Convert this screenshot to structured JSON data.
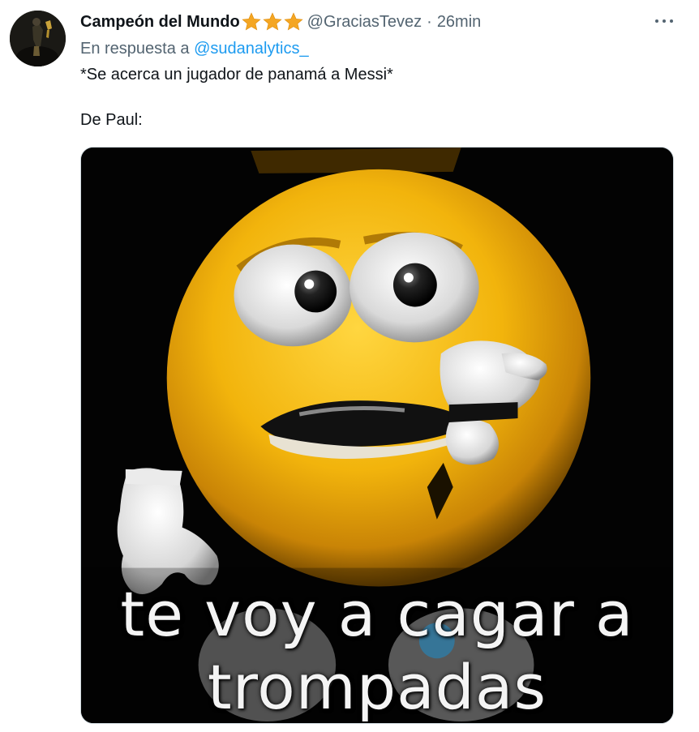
{
  "tweet": {
    "display_name": "Campeón del Mundo",
    "badge_icons": [
      "star-icon",
      "star-icon",
      "star-icon"
    ],
    "handle": "@GraciasTevez",
    "separator": "·",
    "time": "26min",
    "reply_prefix": "En respuesta a",
    "reply_to": "@sudanalytics_",
    "text_line_1": "*Se acerca un jugador de panamá a Messi*",
    "text_line_2": "De Paul:"
  },
  "media": {
    "caption_line_1": "te voy a cagar a",
    "caption_line_2": "trompadas"
  },
  "colors": {
    "link": "#1d9bf0",
    "secondary_text": "#536471",
    "star": "#f4a623"
  }
}
